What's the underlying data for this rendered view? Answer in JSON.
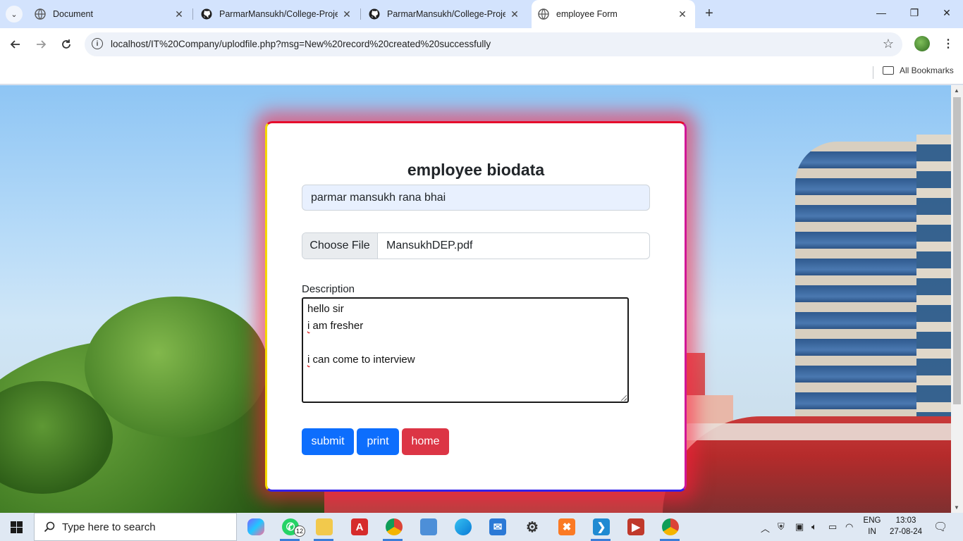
{
  "browser": {
    "tabs": [
      {
        "title": "Document",
        "favicon": "globe-icon"
      },
      {
        "title": "ParmarMansukh/College-Proje",
        "favicon": "github-icon"
      },
      {
        "title": "ParmarMansukh/College-Proje",
        "favicon": "github-icon"
      },
      {
        "title": "employee Form",
        "favicon": "globe-icon",
        "active": true
      }
    ],
    "url": "localhost/IT%20Company/uplodfile.php?msg=New%20record%20created%20successfully",
    "bookmarks_label": "All Bookmarks"
  },
  "form": {
    "title": "employee biodata",
    "name_value": "parmar mansukh rana bhai",
    "file_button": "Choose File",
    "file_name": "MansukhDEP.pdf",
    "description_label": "Description",
    "description_lines": [
      "hello sir",
      "i am fresher",
      "",
      "i can come to interview"
    ],
    "buttons": {
      "submit": "submit",
      "print": "print",
      "home": "home"
    },
    "colors": {
      "primary": "#0d6efd",
      "danger": "#dc3545",
      "border_top": "#e60b2c",
      "border_left": "#f5d800",
      "border_right": "#d11796",
      "border_bottom": "#3320e8"
    }
  },
  "taskbar": {
    "search_placeholder": "Type here to search",
    "whatsapp_badge": "12",
    "language": "ENG",
    "region": "IN",
    "time": "13:03",
    "date": "27-08-24"
  }
}
